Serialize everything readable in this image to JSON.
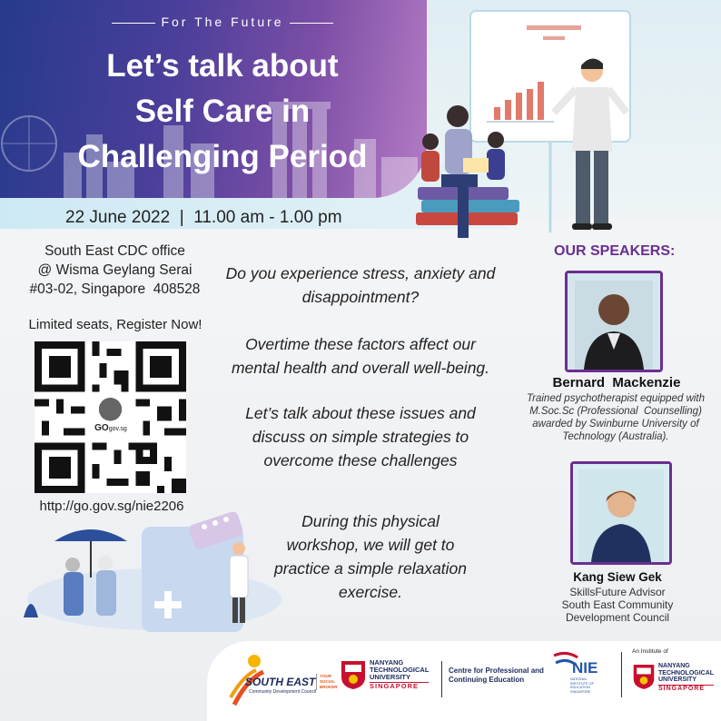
{
  "header": {
    "tagline": "For The Future",
    "title_lines": [
      "Let’s talk about",
      "Self Care in",
      "Challenging Period"
    ],
    "date_time": "22 June 2022  |  11.00 am - 1.00 pm"
  },
  "venue": {
    "lines": [
      "South East CDC office",
      "@ Wisma Geylang Serai",
      "#03-02, Singapore  408528"
    ]
  },
  "registration": {
    "cta": "Limited seats, Register Now!",
    "qr_logo": "GO",
    "qr_logo_domain": "gov.sg",
    "url": "http://go.gov.sg/nie2206"
  },
  "body": {
    "para1": [
      "Do you experience stress, anxiety and",
      "disappointment?"
    ],
    "para2": [
      "Overtime these factors affect our",
      "mental health and overall well-being."
    ],
    "para3": [
      "Let’s talk about these issues and",
      "discuss on simple strategies to",
      "overcome these challenges"
    ],
    "para4": [
      "During this physical",
      "workshop, we will get to",
      "practice a simple relaxation",
      "exercise."
    ]
  },
  "speakers": {
    "heading": "OUR SPEAKERS:",
    "list": [
      {
        "name": "Bernard  Mackenzie",
        "desc": [
          "Trained psychotherapist equipped with",
          "M.Soc.Sc (Professional  Counselling)",
          "awarded by Swinburne University of",
          "Technology (Australia)."
        ]
      },
      {
        "name": "Kang Siew Gek",
        "desc": [
          "SkillsFuture Advisor",
          "South East Community",
          "Development Council"
        ]
      }
    ]
  },
  "footer": {
    "southeast": "SOUTH EAST",
    "southeast_sub": "Community Development Council",
    "southeast_tag": [
      "YOUR",
      "SOCIAL",
      "BROKER"
    ],
    "ntu": [
      "NANYANG",
      "TECHNOLOGICAL",
      "UNIVERSITY"
    ],
    "ntu_country": "SINGAPORE",
    "cpce": [
      "Centre for Professional and",
      "Continuing Education"
    ],
    "nie": "NIE",
    "nie_sub": [
      "NATIONAL",
      "INSTITUTE OF",
      "EDUCATION",
      "SINGAPORE"
    ],
    "institute_of": "An Institute of"
  },
  "colors": {
    "banner_start": "#263a8c",
    "banner_end": "#b57cc4",
    "speaker_accent": "#6b2e91",
    "ntu_red": "#c8102e",
    "southeast_orange": "#f39c12"
  }
}
